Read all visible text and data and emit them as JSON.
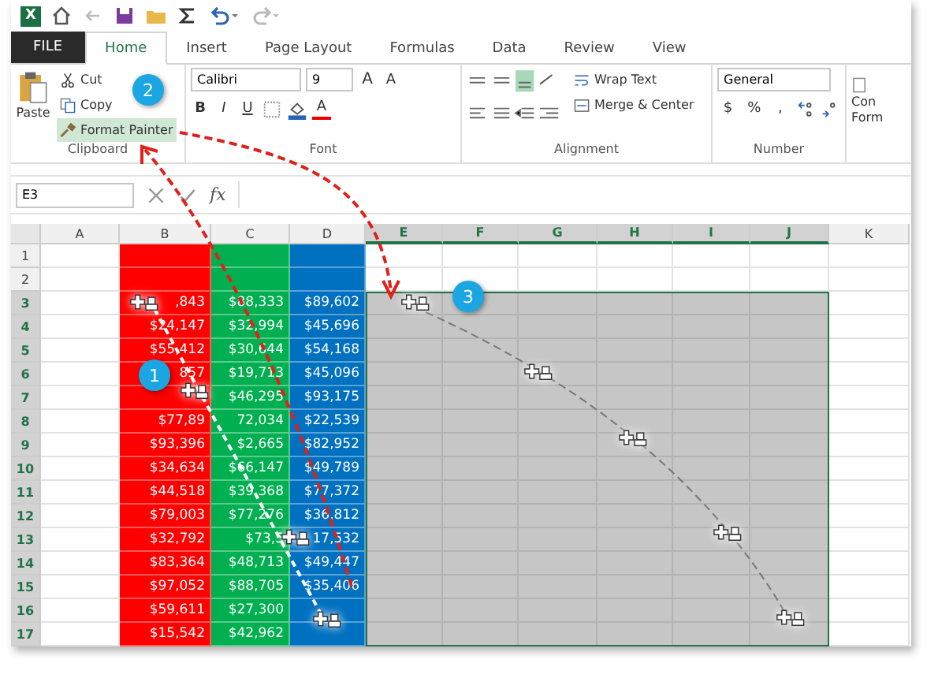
{
  "quick_access": {
    "logo": "X"
  },
  "tabs": [
    {
      "label": "FILE",
      "kind": "file",
      "selected": false
    },
    {
      "label": "Home",
      "kind": "tab",
      "selected": true
    },
    {
      "label": "Insert",
      "kind": "tab",
      "selected": false
    },
    {
      "label": "Page Layout",
      "kind": "tab",
      "selected": false
    },
    {
      "label": "Formulas",
      "kind": "tab",
      "selected": false
    },
    {
      "label": "Data",
      "kind": "tab",
      "selected": false
    },
    {
      "label": "Review",
      "kind": "tab",
      "selected": false
    },
    {
      "label": "View",
      "kind": "tab",
      "selected": false
    }
  ],
  "ribbon": {
    "clipboard": {
      "paste": "Paste",
      "cut": "Cut",
      "copy": "Copy",
      "format_painter": "Format Painter",
      "label": "Clipboard"
    },
    "font": {
      "name": "Calibri",
      "size": "9",
      "bold": "B",
      "italic": "I",
      "underline": "U",
      "font_color": "A",
      "grow": "A",
      "shrink": "A",
      "label": "Font"
    },
    "alignment": {
      "wrap": "Wrap Text",
      "merge": "Merge & Center",
      "label": "Alignment"
    },
    "number": {
      "format": "General",
      "currency": "$",
      "percent": "%",
      "comma": ",",
      "label": "Number"
    },
    "styles": {
      "line_1": "Con",
      "line_2": "Form"
    }
  },
  "name_box": "E3",
  "function_label": "fx",
  "columns": [
    {
      "label": "A",
      "selected": false
    },
    {
      "label": "B",
      "selected": false,
      "color": "#ff0000"
    },
    {
      "label": "C",
      "selected": false,
      "color": "#00b050"
    },
    {
      "label": "D",
      "selected": false,
      "color": "#0070c0"
    },
    {
      "label": "E",
      "selected": true
    },
    {
      "label": "F",
      "selected": true
    },
    {
      "label": "G",
      "selected": true
    },
    {
      "label": "H",
      "selected": true
    },
    {
      "label": "I",
      "selected": true
    },
    {
      "label": "J",
      "selected": true
    },
    {
      "label": "K",
      "selected": false
    }
  ],
  "rows": [
    {
      "label": "1",
      "selected": false,
      "cells": [
        null,
        null,
        null
      ]
    },
    {
      "label": "2",
      "selected": false,
      "cells": [
        null,
        null,
        null
      ]
    },
    {
      "label": "3",
      "selected": true,
      "cells": [
        ",843",
        "$88,333",
        "$89,602"
      ]
    },
    {
      "label": "4",
      "selected": true,
      "cells": [
        "$24,147",
        "$32,994",
        "$45,696"
      ]
    },
    {
      "label": "5",
      "selected": true,
      "cells": [
        "$55,412",
        "$30,644",
        "$54,168"
      ]
    },
    {
      "label": "6",
      "selected": true,
      "cells": [
        "857",
        "$19,713",
        "$45,096"
      ]
    },
    {
      "label": "7",
      "selected": true,
      "cells": [
        null,
        "$46,295",
        "$93,175"
      ]
    },
    {
      "label": "8",
      "selected": true,
      "cells": [
        "$77,89",
        "72,034",
        "$22,539"
      ]
    },
    {
      "label": "9",
      "selected": true,
      "cells": [
        "$93,396",
        "$2,665",
        "$82,952"
      ]
    },
    {
      "label": "10",
      "selected": true,
      "cells": [
        "$34,634",
        "$66,147",
        "$49,789"
      ]
    },
    {
      "label": "11",
      "selected": true,
      "cells": [
        "$44,518",
        "$39,368",
        "$77,372"
      ]
    },
    {
      "label": "12",
      "selected": true,
      "cells": [
        "$79,003",
        "$77,276",
        "$36,812"
      ]
    },
    {
      "label": "13",
      "selected": true,
      "cells": [
        "$32,792",
        "$73,5",
        "17,532"
      ]
    },
    {
      "label": "14",
      "selected": true,
      "cells": [
        "$83,364",
        "$48,713",
        "$49,447"
      ]
    },
    {
      "label": "15",
      "selected": true,
      "cells": [
        "$97,052",
        "$88,705",
        "$35,406"
      ]
    },
    {
      "label": "16",
      "selected": true,
      "cells": [
        "$59,611",
        "$27,300",
        null
      ]
    },
    {
      "label": "17",
      "selected": true,
      "cells": [
        "$15,542",
        "$42,962",
        null
      ]
    }
  ],
  "steps": [
    {
      "label": "1"
    },
    {
      "label": "2"
    },
    {
      "label": "3"
    }
  ]
}
